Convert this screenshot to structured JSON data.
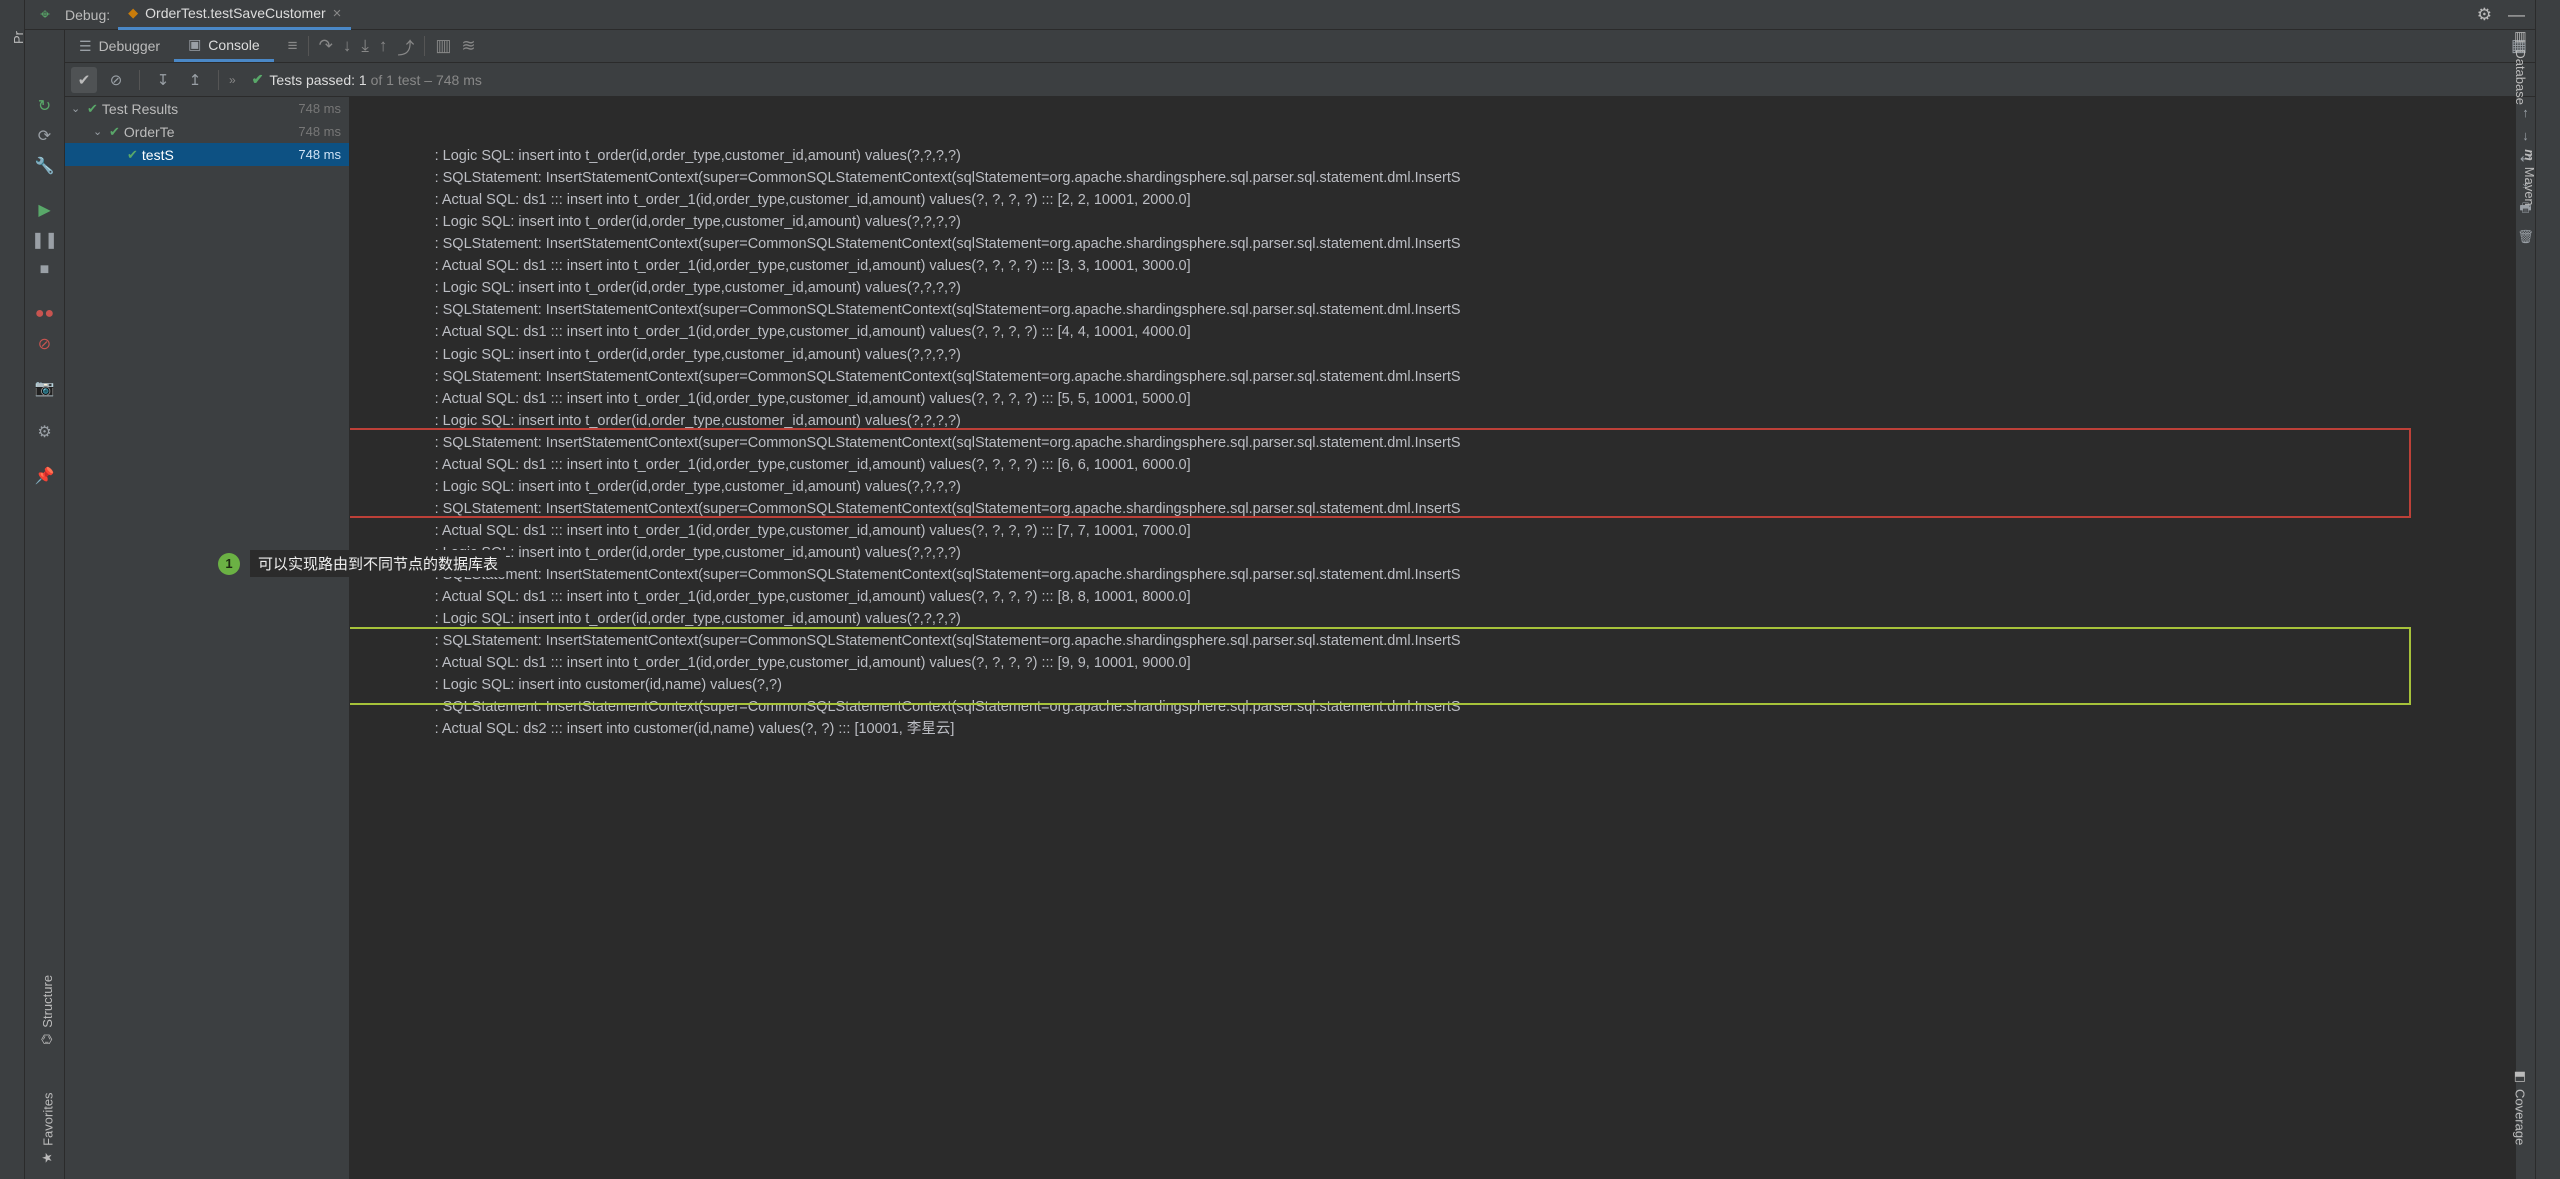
{
  "header": {
    "debug_label": "Debug:",
    "run_tab_label": "OrderTest.testSaveCustomer"
  },
  "tabs": {
    "debugger_label": "Debugger",
    "console_label": "Console"
  },
  "filters": {
    "passed_label_prefix": "Tests passed: ",
    "passed_count": "1",
    "passed_of": " of 1 test",
    "passed_time": " – 748 ms"
  },
  "tree": {
    "root_label": "Test Results",
    "root_ms": "748 ms",
    "node1_label": "OrderTe",
    "node1_ms": "748 ms",
    "node2_label": "testS",
    "node2_ms": "748 ms"
  },
  "left_strip": {
    "project": "Project",
    "structure": "Structure",
    "favorites": "Favorites"
  },
  "right_strip": {
    "database": "Database",
    "maven": "Maven",
    "coverage": "Coverage"
  },
  "callout": {
    "text": "可以实现路由到不同节点的数据库表"
  },
  "console_lines": [
    "                    : Logic SQL: insert into t_order(id,order_type,customer_id,amount) values(?,?,?,?)",
    "                    : SQLStatement: InsertStatementContext(super=CommonSQLStatementContext(sqlStatement=org.apache.shardingsphere.sql.parser.sql.statement.dml.InsertS",
    "                    : Actual SQL: ds1 ::: insert into t_order_1(id,order_type,customer_id,amount) values(?, ?, ?, ?) ::: [2, 2, 10001, 2000.0]",
    "                    : Logic SQL: insert into t_order(id,order_type,customer_id,amount) values(?,?,?,?)",
    "                    : SQLStatement: InsertStatementContext(super=CommonSQLStatementContext(sqlStatement=org.apache.shardingsphere.sql.parser.sql.statement.dml.InsertS",
    "                    : Actual SQL: ds1 ::: insert into t_order_1(id,order_type,customer_id,amount) values(?, ?, ?, ?) ::: [3, 3, 10001, 3000.0]",
    "                    : Logic SQL: insert into t_order(id,order_type,customer_id,amount) values(?,?,?,?)",
    "                    : SQLStatement: InsertStatementContext(super=CommonSQLStatementContext(sqlStatement=org.apache.shardingsphere.sql.parser.sql.statement.dml.InsertS",
    "                    : Actual SQL: ds1 ::: insert into t_order_1(id,order_type,customer_id,amount) values(?, ?, ?, ?) ::: [4, 4, 10001, 4000.0]",
    "                    : Logic SQL: insert into t_order(id,order_type,customer_id,amount) values(?,?,?,?)",
    "                    : SQLStatement: InsertStatementContext(super=CommonSQLStatementContext(sqlStatement=org.apache.shardingsphere.sql.parser.sql.statement.dml.InsertS",
    "                    : Actual SQL: ds1 ::: insert into t_order_1(id,order_type,customer_id,amount) values(?, ?, ?, ?) ::: [5, 5, 10001, 5000.0]",
    "                    : Logic SQL: insert into t_order(id,order_type,customer_id,amount) values(?,?,?,?)",
    "                    : SQLStatement: InsertStatementContext(super=CommonSQLStatementContext(sqlStatement=org.apache.shardingsphere.sql.parser.sql.statement.dml.InsertS",
    "                    : Actual SQL: ds1 ::: insert into t_order_1(id,order_type,customer_id,amount) values(?, ?, ?, ?) ::: [6, 6, 10001, 6000.0]",
    "                    : Logic SQL: insert into t_order(id,order_type,customer_id,amount) values(?,?,?,?)",
    "                    : SQLStatement: InsertStatementContext(super=CommonSQLStatementContext(sqlStatement=org.apache.shardingsphere.sql.parser.sql.statement.dml.InsertS",
    "                    : Actual SQL: ds1 ::: insert into t_order_1(id,order_type,customer_id,amount) values(?, ?, ?, ?) ::: [7, 7, 10001, 7000.0]",
    "                    : Logic SQL: insert into t_order(id,order_type,customer_id,amount) values(?,?,?,?)",
    "                    : SQLStatement: InsertStatementContext(super=CommonSQLStatementContext(sqlStatement=org.apache.shardingsphere.sql.parser.sql.statement.dml.InsertS",
    "                    : Actual SQL: ds1 ::: insert into t_order_1(id,order_type,customer_id,amount) values(?, ?, ?, ?) ::: [8, 8, 10001, 8000.0]",
    "                    : Logic SQL: insert into t_order(id,order_type,customer_id,amount) values(?,?,?,?)",
    "                    : SQLStatement: InsertStatementContext(super=CommonSQLStatementContext(sqlStatement=org.apache.shardingsphere.sql.parser.sql.statement.dml.InsertS",
    "                    : Actual SQL: ds1 ::: insert into t_order_1(id,order_type,customer_id,amount) values(?, ?, ?, ?) ::: [9, 9, 10001, 9000.0]",
    "                    : Logic SQL: insert into customer(id,name) values(?,?)",
    "                    : SQLStatement: InsertStatementContext(super=CommonSQLStatementContext(sqlStatement=org.apache.shardingsphere.sql.parser.sql.statement.dml.InsertS",
    "                    : Actual SQL: ds2 ::: insert into customer(id,name) values(?, ?) ::: [10001, 李星云]",
    ""
  ]
}
